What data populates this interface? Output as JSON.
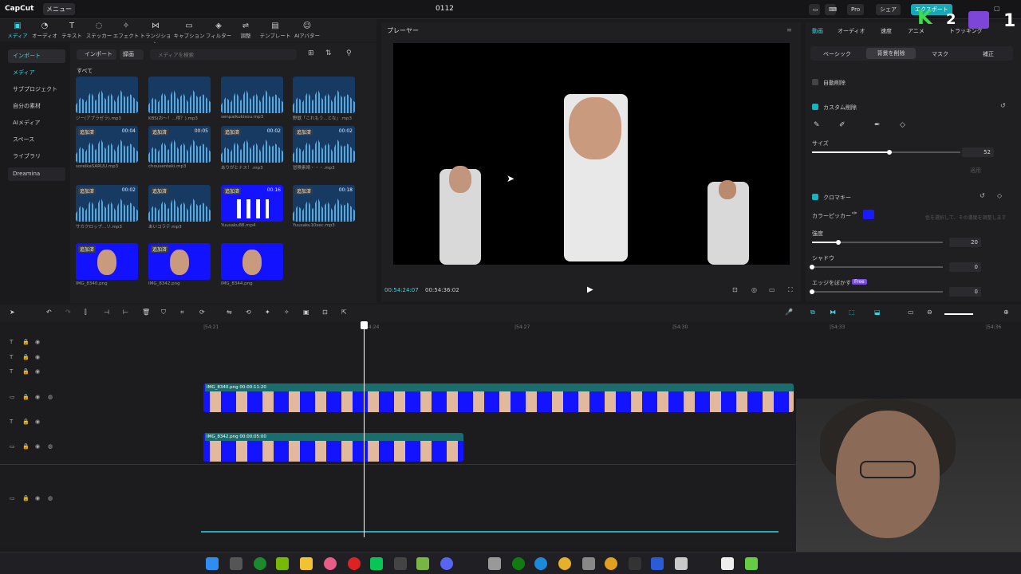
{
  "app": {
    "logo": "CapCut",
    "menu": "メニュー",
    "project_title": "0112",
    "pro_label": "Pro",
    "share_label": "シェア",
    "export_label": "エクスポート"
  },
  "toolbar": [
    {
      "label": "メディア",
      "icon": "▣"
    },
    {
      "label": "オーディオ",
      "icon": "◔"
    },
    {
      "label": "テキスト",
      "icon": "T"
    },
    {
      "label": "ステッカー",
      "icon": "◌"
    },
    {
      "label": "エフェクト",
      "icon": "✧"
    },
    {
      "label": "トランジション",
      "icon": "⋈"
    },
    {
      "label": "キャプション",
      "icon": "▭"
    },
    {
      "label": "フィルター",
      "icon": "◈"
    },
    {
      "label": "調整",
      "icon": "⇌"
    },
    {
      "label": "テンプレート",
      "icon": "▤"
    },
    {
      "label": "AIアバター",
      "icon": "☺"
    }
  ],
  "sidebar": [
    {
      "label": "インポート"
    },
    {
      "label": "メディア"
    },
    {
      "label": "サブプロジェクト"
    },
    {
      "label": "自分の素材"
    },
    {
      "label": "AIメディア"
    },
    {
      "label": "スペース"
    },
    {
      "label": "ライブラリ"
    },
    {
      "label": "Dreamina"
    }
  ],
  "media": {
    "import_button": "インポート",
    "record_button": "録画",
    "search_placeholder": "メディアを検索",
    "all_label": "すべて",
    "items": [
      {
        "name": "ジー(アプラゼラ).mp3",
        "badge": "",
        "duration": "",
        "type": "audio"
      },
      {
        "name": "KBS(お〜！...得？).mp3",
        "badge": "",
        "duration": "",
        "type": "audio"
      },
      {
        "name": "senpaikukisou.mp3",
        "badge": "",
        "duration": "",
        "type": "audio"
      },
      {
        "name": "野獣「これもう...とな」.mp3",
        "badge": "",
        "duration": "",
        "type": "audio"
      },
      {
        "name": "soreikaSARUU.mp3",
        "badge": "追加済",
        "duration": "00:04",
        "type": "audio"
      },
      {
        "name": "chousenteki.mp3",
        "badge": "追加済",
        "duration": "00:05",
        "type": "audio"
      },
      {
        "name": "ありがとナス！.mp3",
        "badge": "追加済",
        "duration": "00:02",
        "type": "audio"
      },
      {
        "name": "冒険素晴・・・.mp3",
        "badge": "追加済",
        "duration": "00:02",
        "type": "audio"
      },
      {
        "name": "サカクロップ...リ.mp3",
        "badge": "追加済",
        "duration": "00:02",
        "type": "audio"
      },
      {
        "name": "あいコラテ.mp3",
        "badge": "追加済",
        "duration": "",
        "type": "audio"
      },
      {
        "name": "Yuusaku88.mp4",
        "badge": "追加済",
        "duration": "00:16",
        "type": "video"
      },
      {
        "name": "Yuusaku10sec.mp3",
        "badge": "追加済",
        "duration": "00:18",
        "type": "audio"
      },
      {
        "name": "IMG_8340.png",
        "badge": "追加済",
        "duration": "",
        "type": "face"
      },
      {
        "name": "IMG_8342.png",
        "badge": "追加済",
        "duration": "",
        "type": "face"
      },
      {
        "name": "IMG_8344.png",
        "badge": "",
        "duration": "",
        "type": "face"
      }
    ]
  },
  "player": {
    "title": "プレーヤー",
    "current_time": "00:54:24:07",
    "total_time": "00:54:36:02"
  },
  "inspector": {
    "tabs": [
      "動画",
      "オーディオ",
      "速度",
      "アニメ",
      "トラッキング"
    ],
    "subtabs": [
      "ベーシック",
      "背景を削除",
      "マスク",
      "補正"
    ],
    "auto_remove": "自動削除",
    "custom_remove": "カスタム削除",
    "size_label": "サイズ",
    "size_value": "52",
    "size_fraction": 0.52,
    "apply_label": "適用",
    "chroma_key": "クロマキー",
    "color_picker": "カラーピッカー",
    "picker_hint": "色を選択して、その濃度を調整します",
    "intensity_label": "強度",
    "intensity_value": "20",
    "intensity_fraction": 0.2,
    "shadow_label": "シャドウ",
    "shadow_value": "0",
    "shadow_fraction": 0,
    "edge_label": "エッジをぼかす",
    "edge_value": "0",
    "edge_fraction": 0,
    "free_badge": "Free",
    "key_color": "#1a1aff"
  },
  "timeline": {
    "ruler": [
      "|54:21",
      "|54:24",
      "|54:27",
      "|54:30",
      "|54:33",
      "|54:36"
    ],
    "clip1": "IMG_8340.png  00:00:11:20",
    "clip2": "IMG_8342.png  00:00:05:00"
  },
  "overlay": {
    "k_label": "K",
    "k2_label": "2",
    "corner_number": "1"
  },
  "colors": {
    "accent": "#3ed3e0",
    "background": "#1b1b1d",
    "clip_blue": "#1313ff"
  }
}
